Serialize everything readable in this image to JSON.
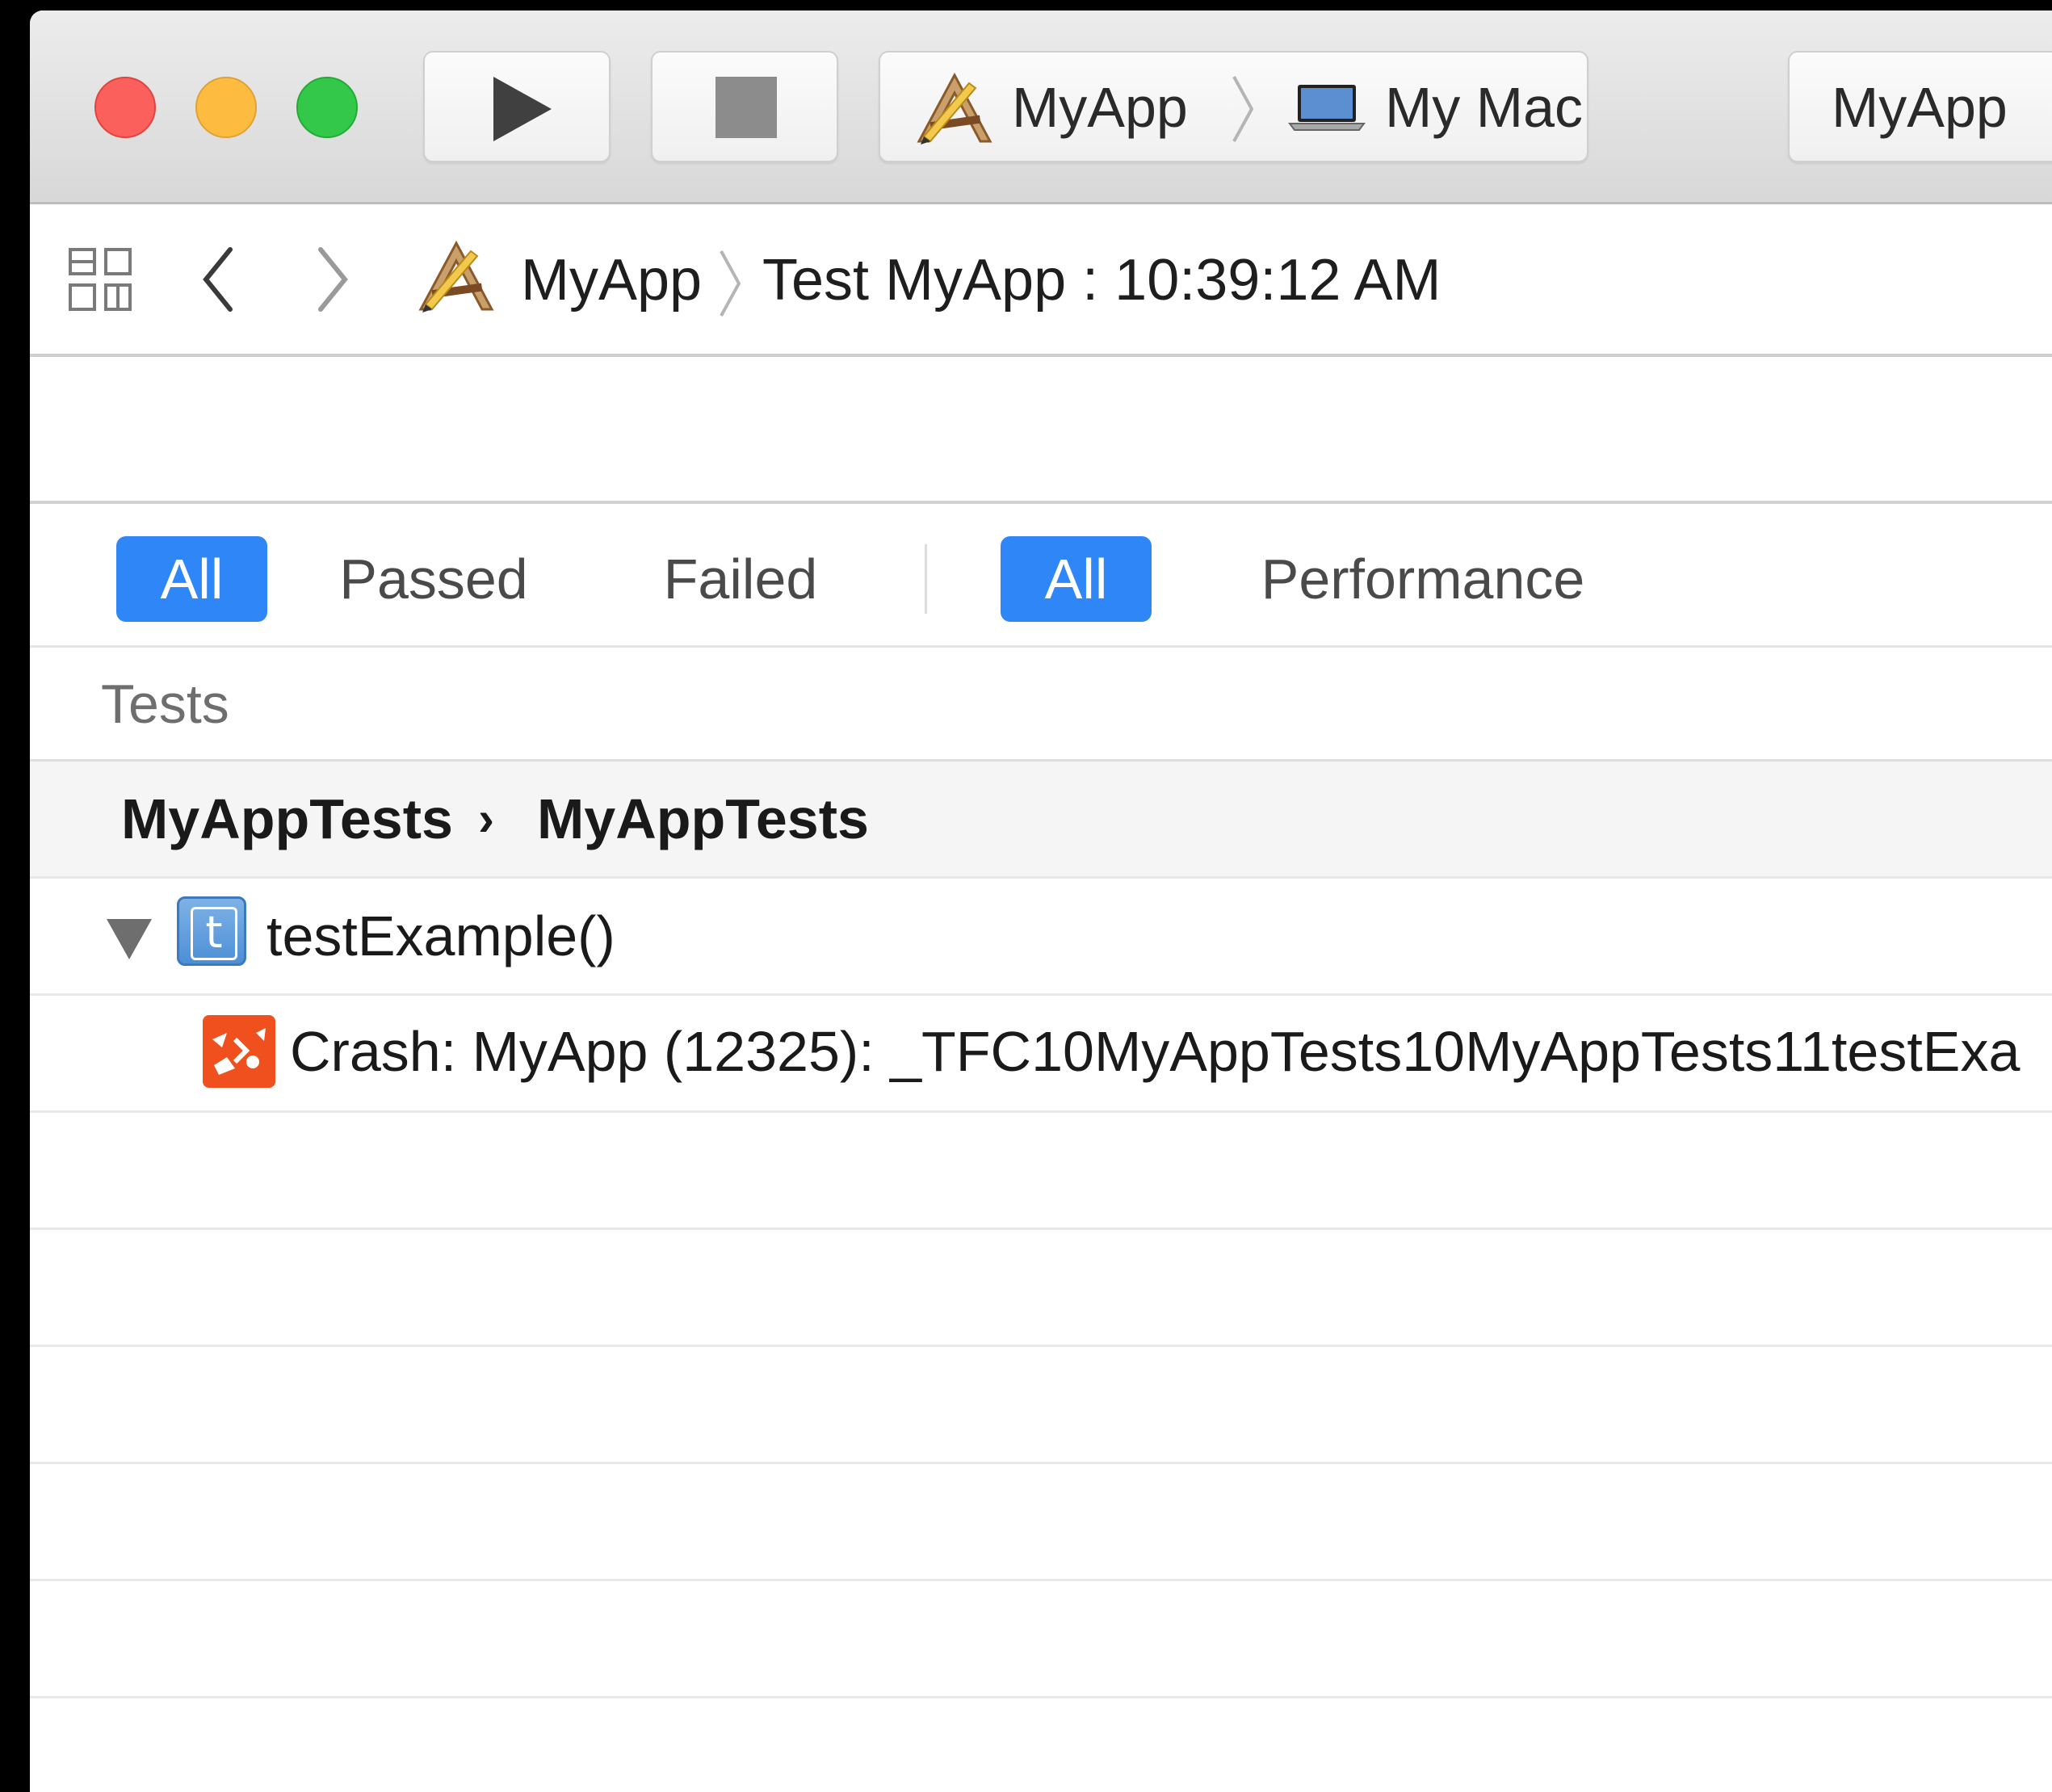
{
  "toolbar": {
    "scheme_app": "MyApp",
    "scheme_destination": "My Mac",
    "activity_status": "MyApp"
  },
  "jump_bar": {
    "project": "MyApp",
    "report": "Test MyApp : 10:39:12 AM"
  },
  "filters": {
    "status_segments": [
      "All",
      "Passed",
      "Failed"
    ],
    "kind_segments": [
      "All",
      "Performance"
    ],
    "selected_status": "All",
    "selected_kind": "All"
  },
  "tests": {
    "header": "Tests",
    "group_target": "MyAppTests",
    "group_class": "MyAppTests",
    "test_name": "testExample()",
    "crash_message": "Crash: MyApp (12325): _TFC10MyAppTests10MyAppTests11testExa"
  },
  "icons": {
    "traffic_lights": [
      "close-icon",
      "minimize-icon",
      "zoom-icon"
    ],
    "run": "play-icon",
    "stop": "stop-icon",
    "app": "xcode-app-icon",
    "destination": "laptop-icon",
    "grid": "related-items-icon",
    "back": "chevron-left-icon",
    "forward": "chevron-right-icon",
    "test": "test-method-icon",
    "crash": "crash-icon"
  },
  "colors": {
    "accent": "#2f86f7",
    "crash": "#f0501e",
    "close": "#fc605c",
    "minimize": "#fdbc40",
    "zoom": "#34c84a"
  }
}
